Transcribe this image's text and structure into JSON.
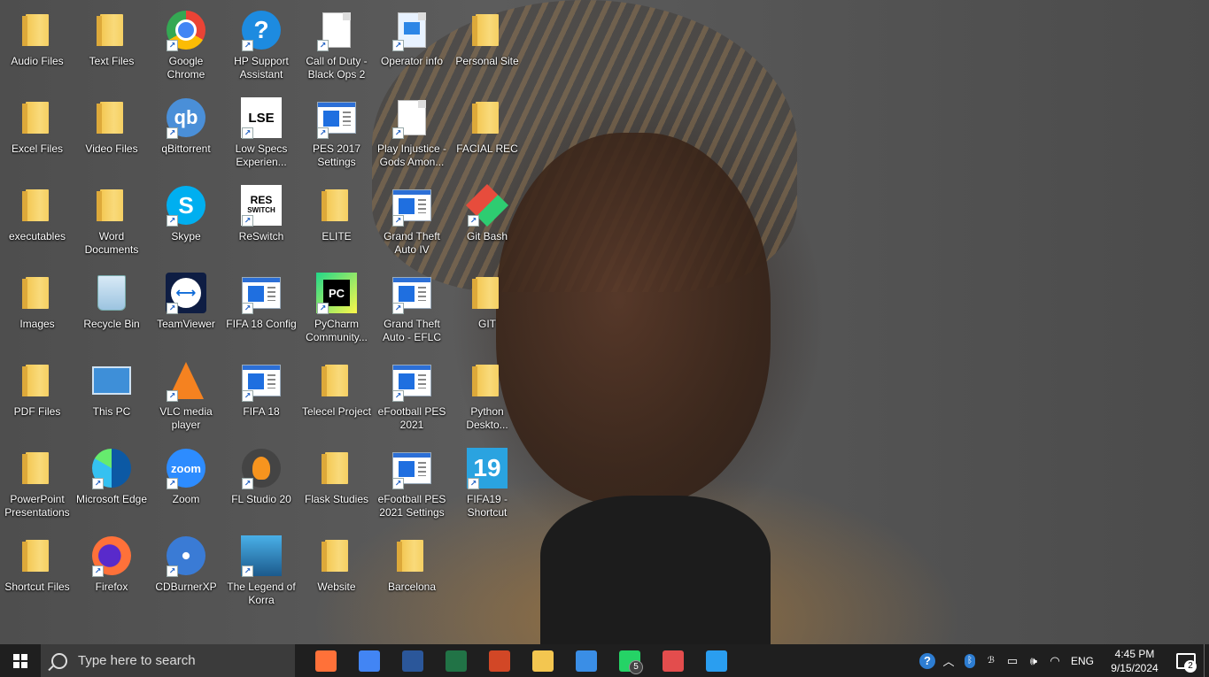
{
  "desktop": {
    "icons": [
      {
        "label": "Audio Files",
        "kind": "folder"
      },
      {
        "label": "Text Files",
        "kind": "folder"
      },
      {
        "label": "Google Chrome",
        "kind": "chrome"
      },
      {
        "label": "HP Support Assistant",
        "kind": "hp"
      },
      {
        "label": "Call of Duty - Black Ops 2",
        "kind": "doc"
      },
      {
        "label": "Operator info",
        "kind": "image"
      },
      {
        "label": "Personal Site",
        "kind": "folder"
      },
      {
        "label": "Excel Files",
        "kind": "folder"
      },
      {
        "label": "Video Files",
        "kind": "folder"
      },
      {
        "label": "qBittorrent",
        "kind": "qbit"
      },
      {
        "label": "Low Specs Experien...",
        "kind": "lse"
      },
      {
        "label": "PES 2017 Settings",
        "kind": "app"
      },
      {
        "label": "Play Injustice - Gods Amon...",
        "kind": "doc"
      },
      {
        "label": "FACIAL REC",
        "kind": "folder"
      },
      {
        "label": "executables",
        "kind": "folder"
      },
      {
        "label": "Word Documents",
        "kind": "folder"
      },
      {
        "label": "Skype",
        "kind": "skype"
      },
      {
        "label": "ReSwitch",
        "kind": "reswitch"
      },
      {
        "label": "ELITE",
        "kind": "folder"
      },
      {
        "label": "Grand Theft Auto IV",
        "kind": "app"
      },
      {
        "label": "Git Bash",
        "kind": "gitbash"
      },
      {
        "label": "Images",
        "kind": "folder"
      },
      {
        "label": "Recycle Bin",
        "kind": "recycle"
      },
      {
        "label": "TeamViewer",
        "kind": "teamviewer"
      },
      {
        "label": "FIFA 18 Config",
        "kind": "app"
      },
      {
        "label": "PyCharm Community...",
        "kind": "pycharm"
      },
      {
        "label": "Grand Theft Auto - EFLC",
        "kind": "app"
      },
      {
        "label": "GIT",
        "kind": "folder"
      },
      {
        "label": "PDF Files",
        "kind": "folder"
      },
      {
        "label": "This PC",
        "kind": "thispc"
      },
      {
        "label": "VLC media player",
        "kind": "vlc"
      },
      {
        "label": "FIFA 18",
        "kind": "app"
      },
      {
        "label": "Telecel Project",
        "kind": "folder"
      },
      {
        "label": "eFootball PES 2021",
        "kind": "app"
      },
      {
        "label": "Python Deskto...",
        "kind": "folder"
      },
      {
        "label": "PowerPoint Presentations",
        "kind": "folder"
      },
      {
        "label": "Microsoft Edge",
        "kind": "edge"
      },
      {
        "label": "Zoom",
        "kind": "zoom"
      },
      {
        "label": "FL Studio 20",
        "kind": "flstudio"
      },
      {
        "label": "Flask Studies",
        "kind": "folder"
      },
      {
        "label": "eFootball PES 2021 Settings",
        "kind": "app"
      },
      {
        "label": "FIFA19 - Shortcut",
        "kind": "fifa19"
      },
      {
        "label": "Shortcut Files",
        "kind": "folder"
      },
      {
        "label": "Firefox",
        "kind": "firefox"
      },
      {
        "label": "CDBurnerXP",
        "kind": "cdburner"
      },
      {
        "label": "The Legend of Korra",
        "kind": "korra"
      },
      {
        "label": "Website",
        "kind": "folder"
      },
      {
        "label": "Barcelona",
        "kind": "folder"
      }
    ]
  },
  "taskbar": {
    "search_placeholder": "Type here to search",
    "apps": [
      {
        "name": "firefox-icon",
        "color": "#ff7139"
      },
      {
        "name": "chrome-icon",
        "color": "#4285f4"
      },
      {
        "name": "word-icon",
        "color": "#2b579a"
      },
      {
        "name": "excel-icon",
        "color": "#217346"
      },
      {
        "name": "powerpoint-icon",
        "color": "#d24726"
      },
      {
        "name": "file-explorer-icon",
        "color": "#f3c650"
      },
      {
        "name": "control-panel-icon",
        "color": "#3a8ee6"
      },
      {
        "name": "whatsapp-icon",
        "color": "#25d366",
        "badge": "5"
      },
      {
        "name": "paint-icon",
        "color": "#e34d4d"
      },
      {
        "name": "vscode-icon",
        "color": "#2a9ef0"
      }
    ],
    "tray": {
      "language": "ENG",
      "time": "4:45 PM",
      "date": "9/15/2024",
      "notifications": "2"
    }
  }
}
